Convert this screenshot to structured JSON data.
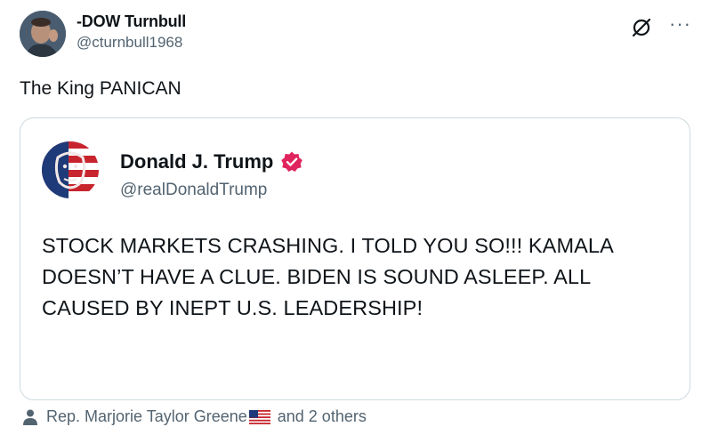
{
  "post": {
    "display_name": "-DOW Turnbull",
    "handle": "@cturnbull1968",
    "text": "The King PANICAN",
    "avatar_icon": "user-avatar",
    "grok_icon": "grok-icon",
    "more_icon": "more-icon",
    "more_label": "···"
  },
  "quote": {
    "display_name": "Donald J. Trump",
    "handle": "@realDonaldTrump",
    "verified_color": "#e0245e",
    "body": "STOCK MARKETS CRASHING. I TOLD YOU SO!!! KAMALA DOESN’T HAVE A CLUE. BIDEN IS SOUND ASLEEP. ALL CAUSED BY INEPT U.S. LEADERSHIP!"
  },
  "likes": {
    "liker": "Rep. Marjorie Taylor Greene",
    "others": "and 2 others",
    "flag_icon": "us-flag-icon",
    "person_icon": "person-icon"
  }
}
